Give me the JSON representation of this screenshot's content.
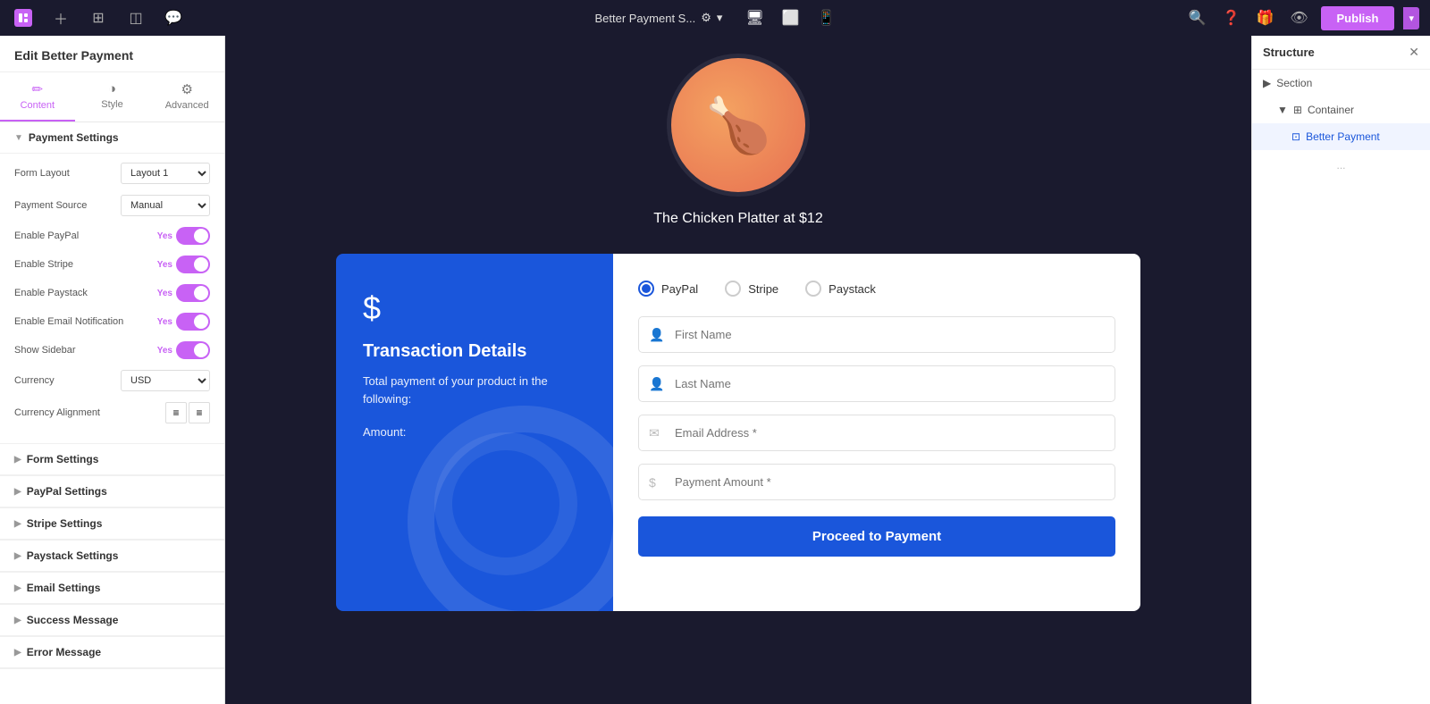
{
  "topbar": {
    "site_name": "Better Payment S...",
    "publish_label": "Publish",
    "settings_icon": "⚙",
    "chevron_down": "▾",
    "chevron_icon": "⌄"
  },
  "left_panel": {
    "header": "Edit Better Payment",
    "tabs": [
      {
        "id": "content",
        "label": "Content",
        "icon": "✏"
      },
      {
        "id": "style",
        "label": "Style",
        "icon": "◑"
      },
      {
        "id": "advanced",
        "label": "Advanced",
        "icon": "⚙"
      }
    ],
    "payment_settings": {
      "title": "Payment Settings",
      "form_layout_label": "Form Layout",
      "form_layout_value": "Layout 1",
      "payment_source_label": "Payment Source",
      "payment_source_value": "Manual",
      "enable_paypal_label": "Enable PayPal",
      "enable_paypal_value": "Yes",
      "enable_stripe_label": "Enable Stripe",
      "enable_stripe_value": "Yes",
      "enable_paystack_label": "Enable Paystack",
      "enable_paystack_value": "Yes",
      "enable_email_label": "Enable Email Notification",
      "enable_email_value": "Yes",
      "show_sidebar_label": "Show Sidebar",
      "show_sidebar_value": "Yes",
      "currency_label": "Currency",
      "currency_value": "USD",
      "currency_alignment_label": "Currency Alignment"
    },
    "sections": [
      {
        "id": "form-settings",
        "label": "Form Settings"
      },
      {
        "id": "paypal-settings",
        "label": "PayPal Settings"
      },
      {
        "id": "stripe-settings",
        "label": "Stripe Settings"
      },
      {
        "id": "paystack-settings",
        "label": "Paystack Settings"
      },
      {
        "id": "email-settings",
        "label": "Email Settings"
      },
      {
        "id": "success-message",
        "label": "Success Message"
      },
      {
        "id": "error-message",
        "label": "Error Message"
      }
    ]
  },
  "canvas": {
    "food_title": "The Chicken Platter at $12",
    "food_emoji": "🍗",
    "payment_sidebar": {
      "dollar_sign": "$",
      "title": "Transaction Details",
      "description": "Total payment of your product in the following:",
      "amount_label": "Amount:"
    },
    "payment_form": {
      "methods": [
        {
          "id": "paypal",
          "label": "PayPal",
          "selected": true
        },
        {
          "id": "stripe",
          "label": "Stripe",
          "selected": false
        },
        {
          "id": "paystack",
          "label": "Paystack",
          "selected": false
        }
      ],
      "first_name_placeholder": "First Name",
      "last_name_placeholder": "Last Name",
      "email_placeholder": "Email Address *",
      "amount_placeholder": "Payment Amount *",
      "proceed_button": "Proceed to Payment"
    }
  },
  "structure_panel": {
    "title": "Structure",
    "items": [
      {
        "id": "section",
        "label": "Section",
        "level": 0,
        "icon": "▶",
        "type": "section"
      },
      {
        "id": "container",
        "label": "Container",
        "level": 1,
        "icon": "□",
        "type": "container"
      },
      {
        "id": "better-payment",
        "label": "Better Payment",
        "level": 2,
        "icon": "□",
        "type": "widget",
        "selected": true
      }
    ]
  }
}
